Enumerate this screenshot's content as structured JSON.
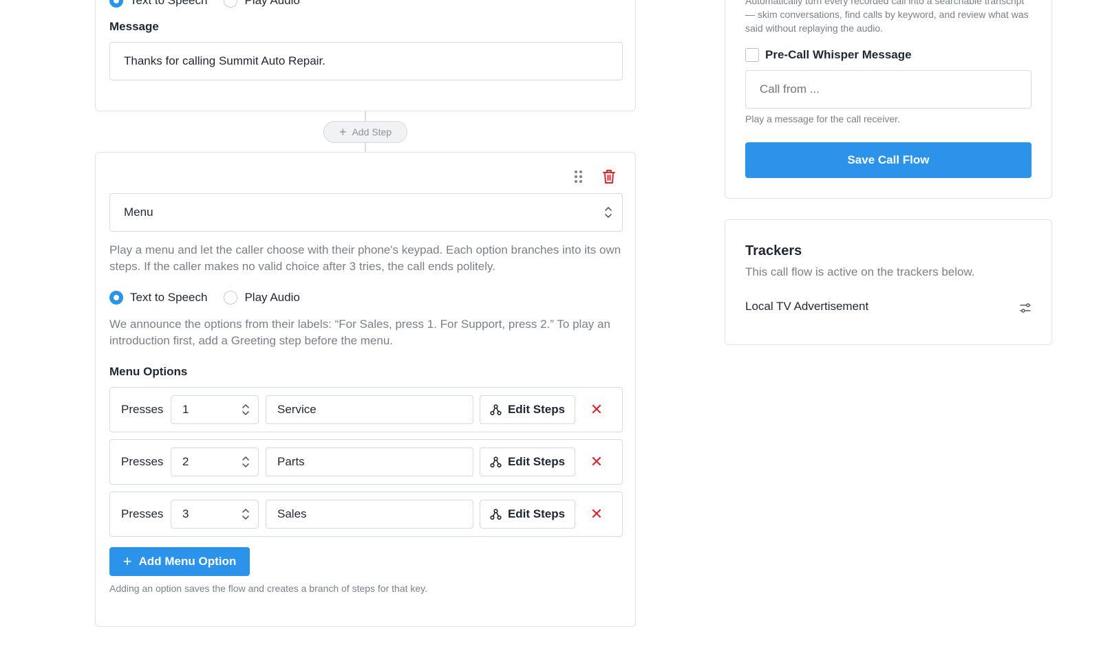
{
  "greeting": {
    "voice_options": [
      "Text to Speech",
      "Play Audio"
    ],
    "selected_voice": "Text to Speech",
    "message_label": "Message",
    "message_value": "Thanks for calling Summit Auto Repair."
  },
  "add_step_label": "Add Step",
  "menu_step": {
    "step_type": "Menu",
    "description": "Play a menu and let the caller choose with their phone's keypad. Each option branches into its own steps. If the caller makes no valid choice after 3 tries, the call ends politely.",
    "voice_options": [
      "Text to Speech",
      "Play Audio"
    ],
    "selected_voice": "Text to Speech",
    "announce_note": "We announce the options from their labels: “For Sales, press 1. For Support, press 2.” To play an introduction first, add a Greeting step before the menu.",
    "options_label": "Menu Options",
    "presses_label": "Presses",
    "edit_steps_label": "Edit Steps",
    "options": [
      {
        "key": "1",
        "name": "Service"
      },
      {
        "key": "2",
        "name": "Parts"
      },
      {
        "key": "3",
        "name": "Sales"
      }
    ],
    "add_option_label": "Add Menu Option",
    "add_option_hint": "Adding an option saves the flow and creates a branch of steps for that key."
  },
  "settings": {
    "transcription_desc": "Automatically turn every recorded call into a searchable transcript — skim conversations, find calls by keyword, and review what was said without replaying the audio.",
    "whisper_label": "Pre-Call Whisper Message",
    "whisper_checked": false,
    "whisper_placeholder": "Call from ...",
    "whisper_help": "Play a message for the call receiver.",
    "save_label": "Save Call Flow"
  },
  "trackers": {
    "title": "Trackers",
    "subtitle": "This call flow is active on the trackers below.",
    "items": [
      "Local TV Advertisement"
    ]
  },
  "colors": {
    "accent": "#2b94ea",
    "danger": "#d7262d",
    "muted_text": "#7a8089",
    "border": "#d5dae0"
  }
}
